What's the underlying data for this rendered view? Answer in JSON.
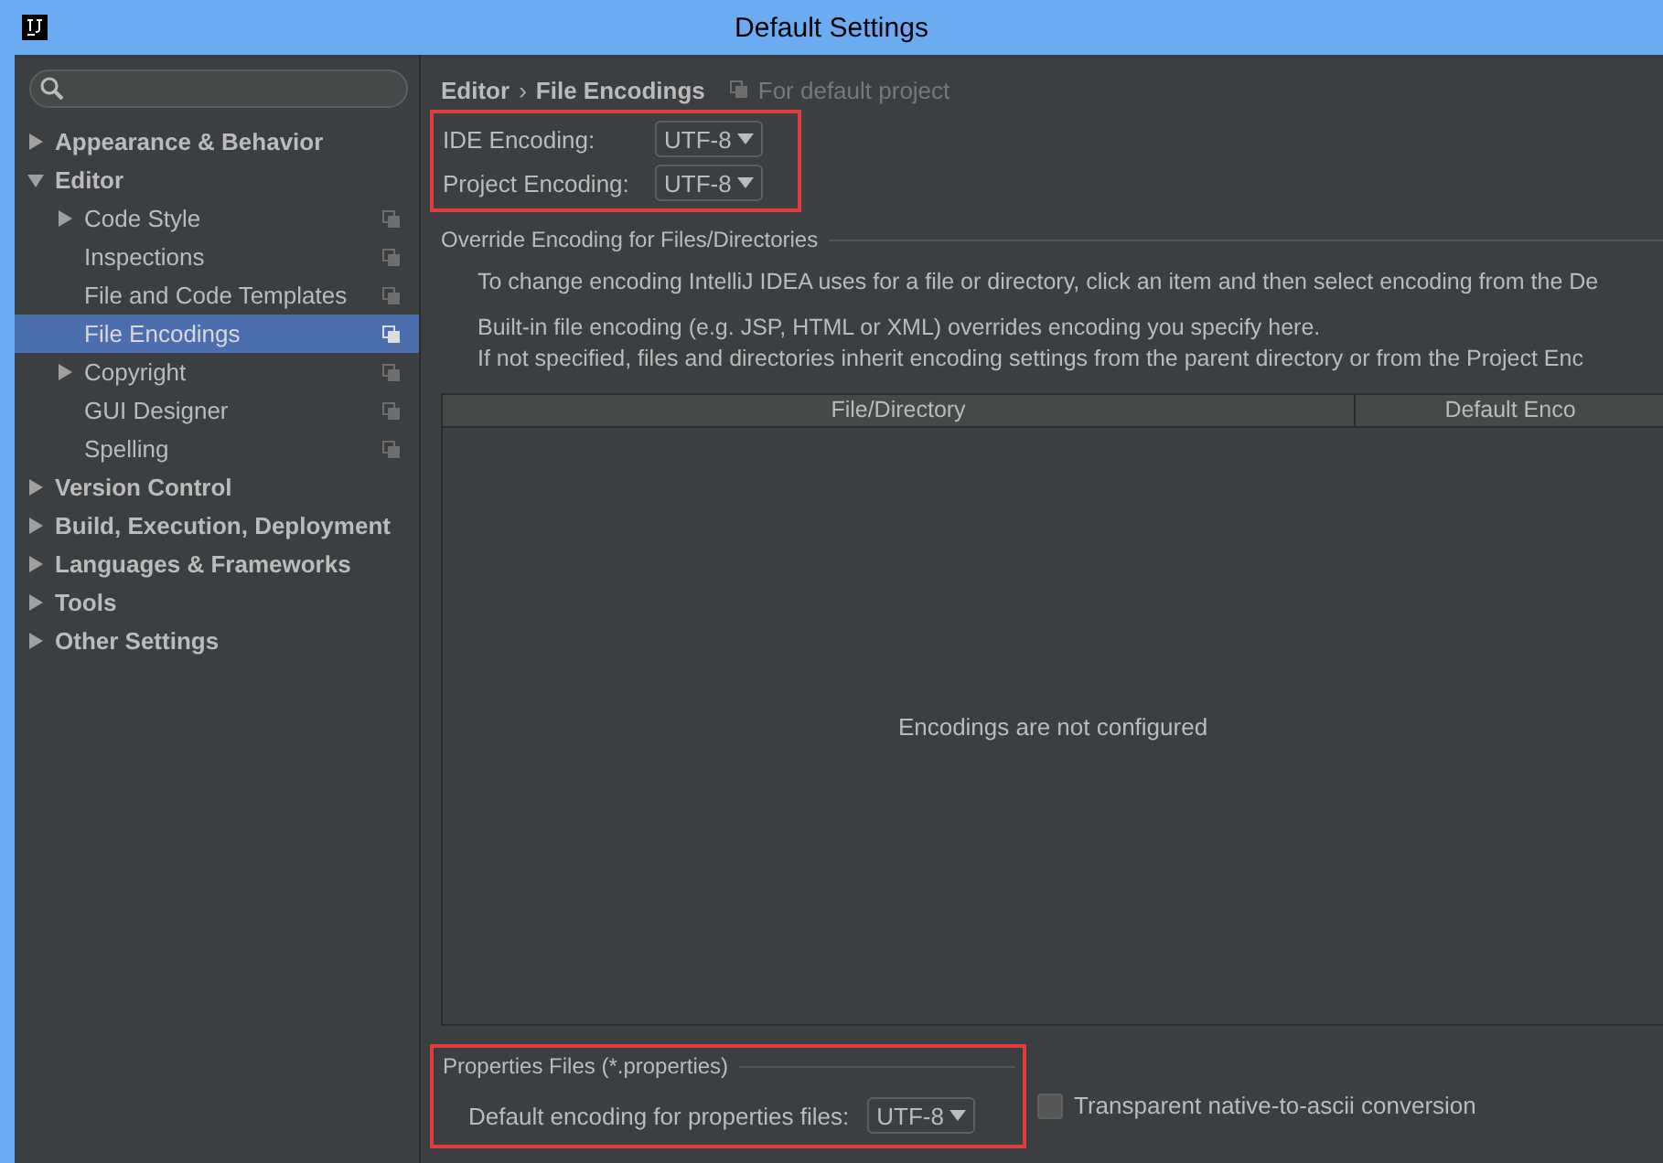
{
  "window": {
    "title": "Default Settings"
  },
  "sidebar": {
    "tree": [
      {
        "label": "Appearance & Behavior",
        "expandable": true,
        "expanded": false,
        "selected": false,
        "project_icon": false
      },
      {
        "label": "Editor",
        "expandable": true,
        "expanded": true,
        "selected": false,
        "project_icon": false,
        "children": [
          {
            "label": "Code Style",
            "expandable": true,
            "expanded": false,
            "selected": false,
            "project_icon": true
          },
          {
            "label": "Inspections",
            "expandable": false,
            "selected": false,
            "project_icon": true
          },
          {
            "label": "File and Code Templates",
            "expandable": false,
            "selected": false,
            "project_icon": true
          },
          {
            "label": "File Encodings",
            "expandable": false,
            "selected": true,
            "project_icon": true
          },
          {
            "label": "Copyright",
            "expandable": true,
            "expanded": false,
            "selected": false,
            "project_icon": true
          },
          {
            "label": "GUI Designer",
            "expandable": false,
            "selected": false,
            "project_icon": true
          },
          {
            "label": "Spelling",
            "expandable": false,
            "selected": false,
            "project_icon": true
          }
        ]
      },
      {
        "label": "Version Control",
        "expandable": true,
        "expanded": false,
        "selected": false,
        "project_icon": false
      },
      {
        "label": "Build, Execution, Deployment",
        "expandable": true,
        "expanded": false,
        "selected": false,
        "project_icon": false
      },
      {
        "label": "Languages & Frameworks",
        "expandable": true,
        "expanded": false,
        "selected": false,
        "project_icon": false
      },
      {
        "label": "Tools",
        "expandable": true,
        "expanded": false,
        "selected": false,
        "project_icon": false
      },
      {
        "label": "Other Settings",
        "expandable": true,
        "expanded": false,
        "selected": false,
        "project_icon": false
      }
    ]
  },
  "breadcrumb": {
    "parent": "Editor",
    "separator": "›",
    "current": "File Encodings",
    "scope": "For default project"
  },
  "encodings": [
    {
      "label": "IDE Encoding:",
      "value": "UTF-8"
    },
    {
      "label": "Project Encoding:",
      "value": "UTF-8"
    }
  ],
  "override": {
    "title": "Override Encoding for Files/Directories",
    "paragraphs": [
      "To change encoding IntelliJ IDEA uses for a file or directory, click an item and then select encoding from the De",
      "Built-in file encoding (e.g. JSP, HTML or XML) overrides encoding you specify here.\nIf not specified, files and directories inherit encoding settings from the parent directory or from the Project Enc"
    ],
    "table": {
      "columns": [
        "File/Directory",
        "Default Enco"
      ],
      "empty_text": "Encodings are not configured"
    }
  },
  "properties": {
    "title": "Properties Files (*.properties)",
    "label": "Default encoding for properties files:",
    "value": "UTF-8",
    "transparent": {
      "label": "Transparent native-to-ascii conversion",
      "checked": false
    }
  }
}
